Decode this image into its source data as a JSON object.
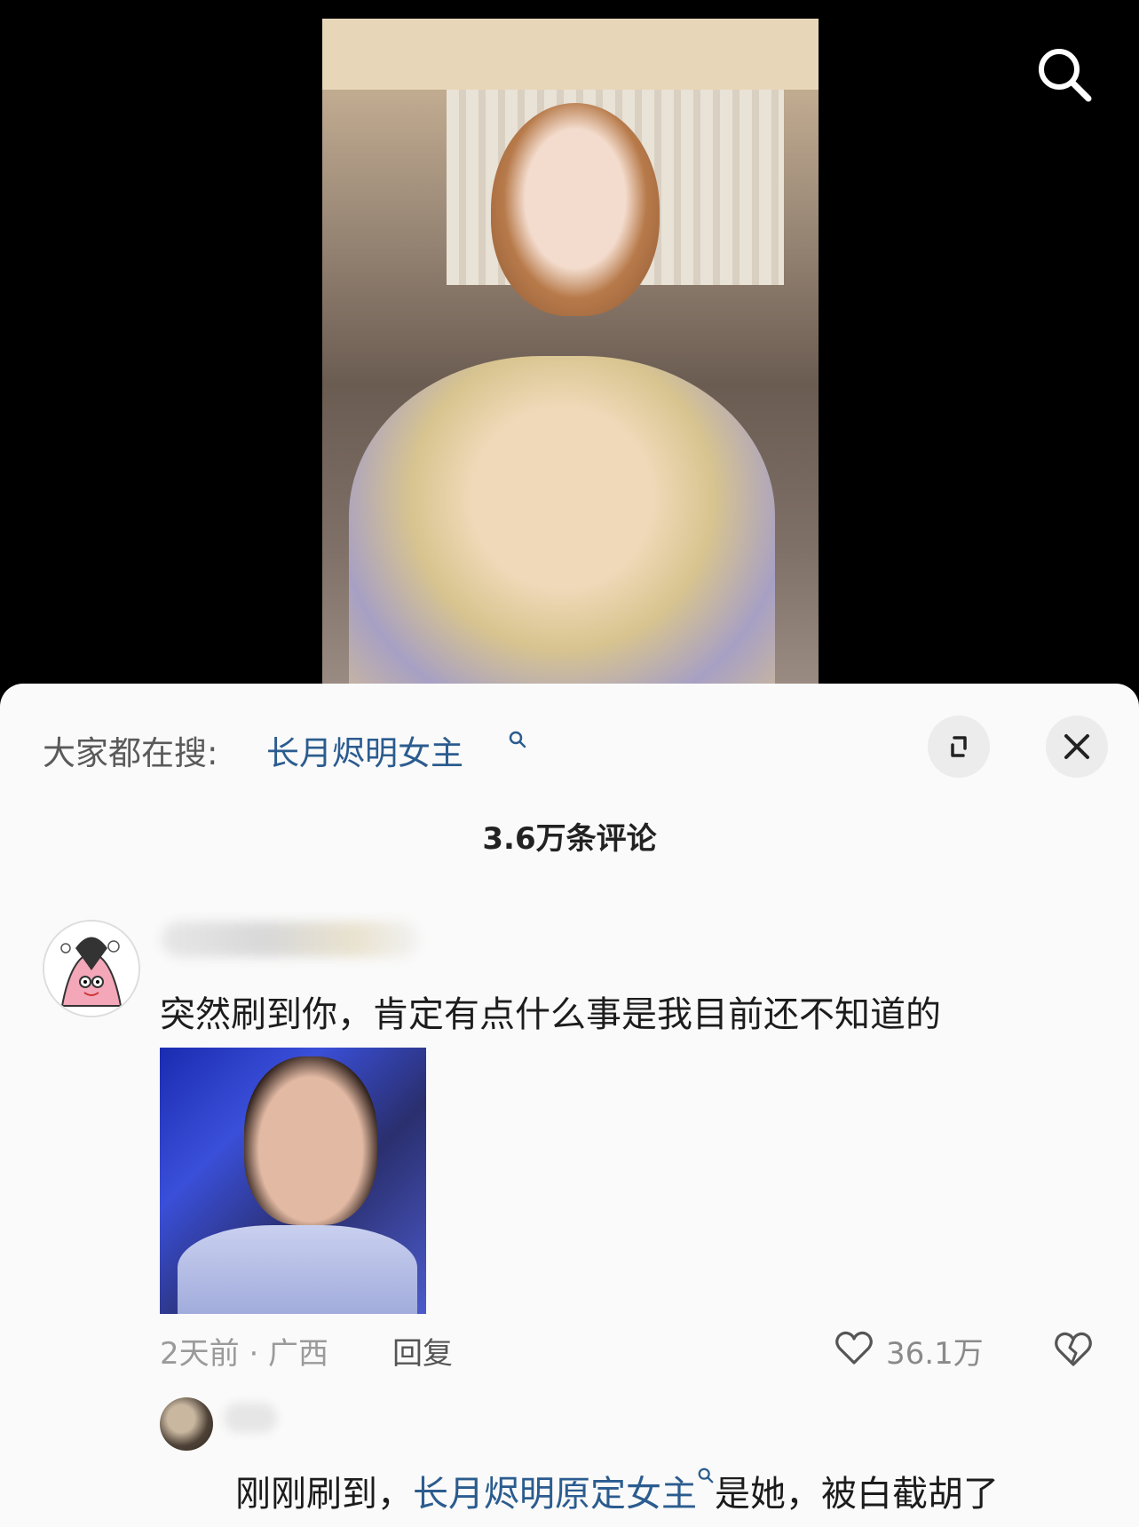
{
  "top_bar": {
    "search_icon": "search-icon"
  },
  "sheet": {
    "trending": {
      "prefix": "大家都在搜:",
      "term": "长月烬明女主"
    },
    "expand_icon": "expand-icon",
    "close_icon": "close-icon",
    "comment_count": "3.6万条评论"
  },
  "comment": {
    "text": "突然刷到你，肯定有点什么事是我目前还不知道的",
    "meta": "2天前 · 广西",
    "reply_label": "回复",
    "like_count": "36.1万"
  },
  "reply": {
    "text_before": "刚刚刷到，",
    "link": "长月烬明原定女主",
    "text_after": "是她，被白截胡了"
  }
}
